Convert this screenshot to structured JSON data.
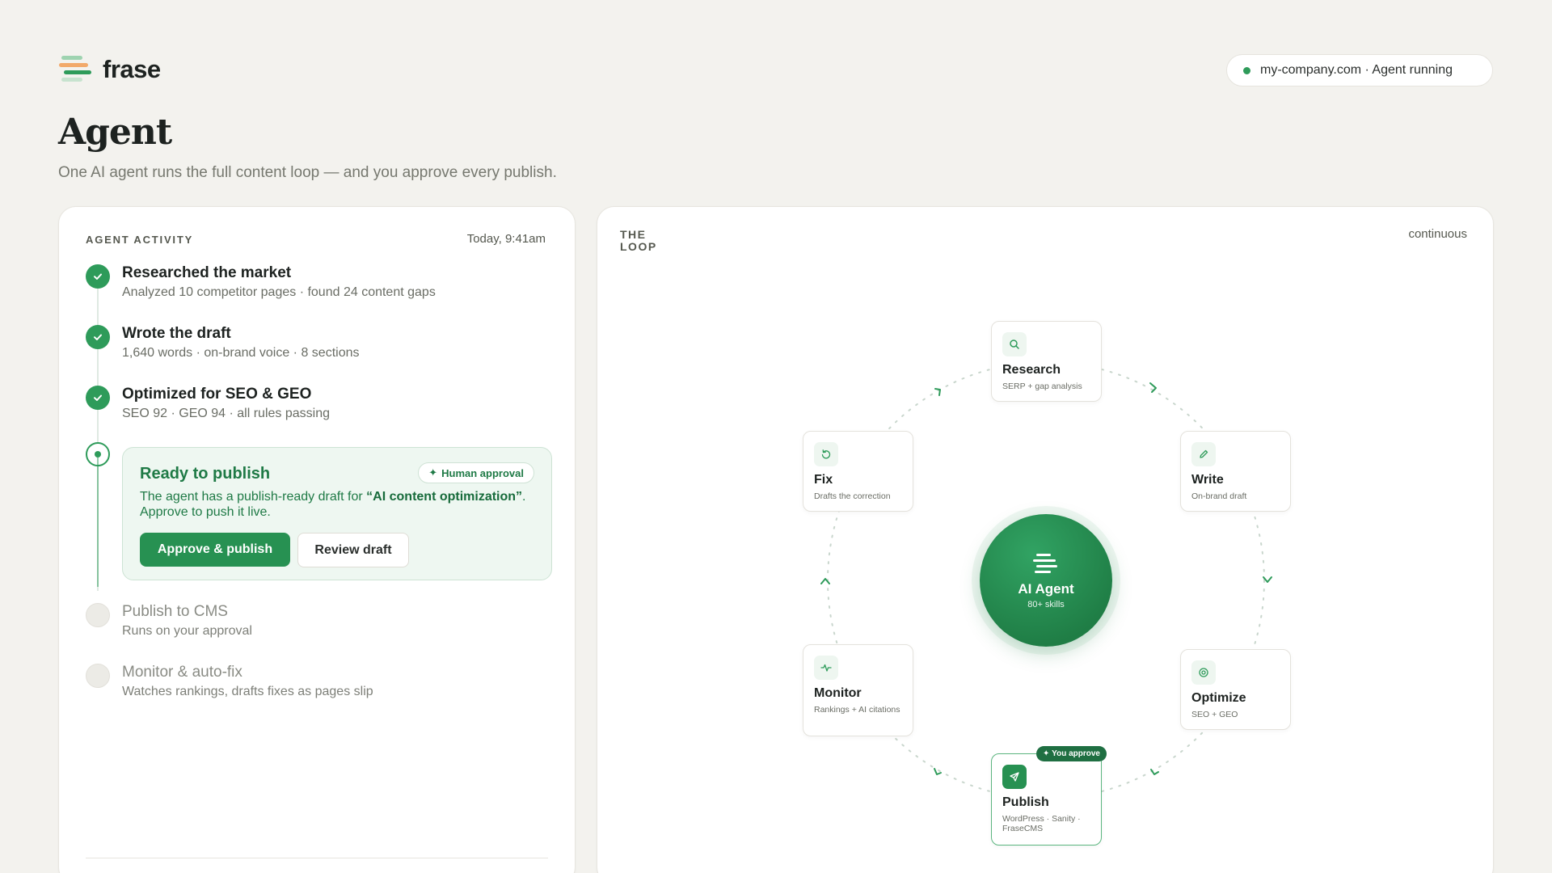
{
  "header": {
    "logo_text": "frase",
    "status": "my-company.com · Agent running",
    "title": "Agent",
    "subtitle": "One AI agent runs the full content loop — and you approve every publish."
  },
  "activity": {
    "label": "AGENT ACTIVITY",
    "time": "Today, 9:41am",
    "steps": [
      {
        "title": "Researched the market",
        "desc": "Analyzed 10 competitor pages · found 24 content gaps",
        "state": "done"
      },
      {
        "title": "Wrote the draft",
        "desc": "1,640 words · on-brand voice · 8 sections",
        "state": "done"
      },
      {
        "title": "Optimized for SEO & GEO",
        "desc": "SEO 92 · GEO 94 · all rules passing",
        "state": "done"
      },
      {
        "title": "Ready to publish",
        "state": "current"
      },
      {
        "title": "Publish to CMS",
        "desc": "Runs on your approval",
        "state": "pending"
      },
      {
        "title": "Monitor & auto-fix",
        "desc": "Watches rankings, drafts fixes as pages slip",
        "state": "pending"
      }
    ],
    "approval": {
      "title": "Ready to publish",
      "badge": "Human approval",
      "text_before": "The agent has a publish-ready draft for ",
      "text_highlight": "“AI content optimization”",
      "text_after": ". Approve to push it live.",
      "approve_label": "Approve & publish",
      "review_label": "Review draft"
    }
  },
  "loop": {
    "label": "THE LOOP",
    "mode": "continuous",
    "center": {
      "name": "AI Agent",
      "skills": "80+ skills"
    },
    "nodes": {
      "research": {
        "title": "Research",
        "desc": "SERP + gap analysis",
        "icon": "search-icon"
      },
      "write": {
        "title": "Write",
        "desc": "On-brand draft",
        "icon": "pencil-icon"
      },
      "optimize": {
        "title": "Optimize",
        "desc": "SEO + GEO",
        "icon": "target-icon"
      },
      "publish": {
        "title": "Publish",
        "desc": "WordPress · Sanity · FraseCMS",
        "icon": "send-icon",
        "badge": "You approve"
      },
      "monitor": {
        "title": "Monitor",
        "desc": "Rankings + AI citations",
        "icon": "pulse-icon"
      },
      "fix": {
        "title": "Fix",
        "desc": "Drafts the correction",
        "icon": "refresh-icon"
      }
    }
  },
  "colors": {
    "accent": "#2e9b5a",
    "accent_dark": "#1f7d45",
    "background": "#f3f2ee",
    "text": "#1d2220"
  }
}
